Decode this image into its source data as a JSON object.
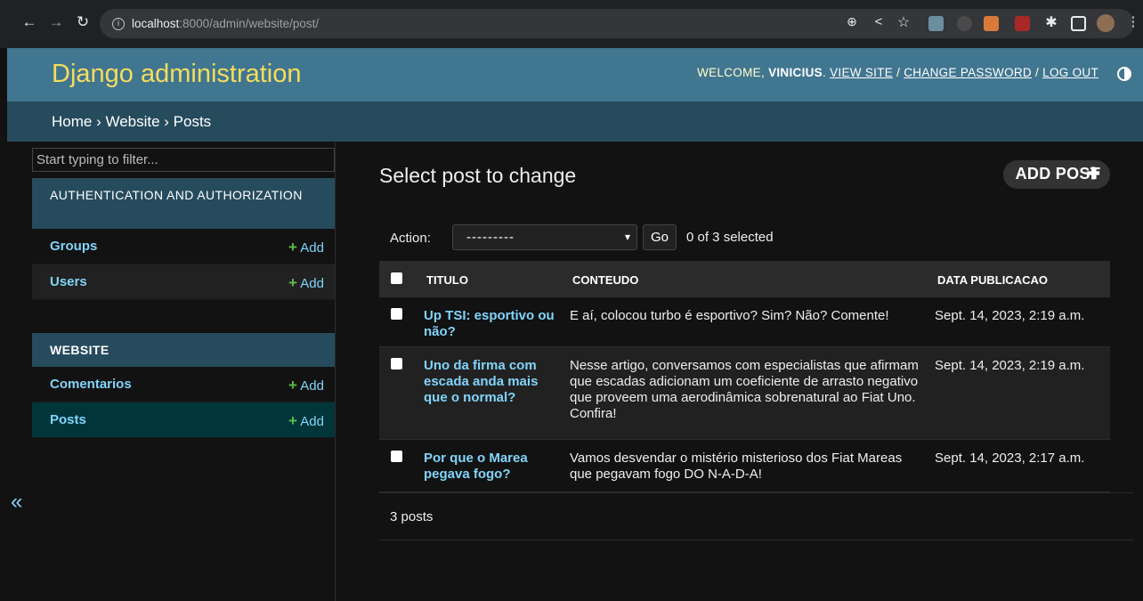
{
  "browser": {
    "url_host": "localhost",
    "url_path": ":8000/admin/website/post/",
    "icons": [
      "back-icon",
      "forward-icon",
      "reload-icon",
      "info-icon",
      "zoom-icon",
      "share-icon",
      "star-icon",
      "extension-icons",
      "profile-avatar"
    ]
  },
  "header": {
    "brand": "Django administration",
    "welcome": "WELCOME, ",
    "user": "VINICIUS",
    "view_site": "VIEW SITE",
    "change_password": "CHANGE PASSWORD",
    "log_out": "LOG OUT",
    "sep": " / "
  },
  "breadcrumbs": "Home › Website › Posts",
  "sidebar": {
    "filter_placeholder": "Start typing to filter...",
    "modules": [
      {
        "caption": "AUTHENTICATION AND AUTHORIZATION",
        "rows": [
          "Groups",
          "Users"
        ]
      },
      {
        "caption": "WEBSITE",
        "rows": [
          "Comentarios",
          "Posts"
        ]
      }
    ],
    "add_label": "Add",
    "collapse": "«"
  },
  "main": {
    "title": "Select post to change",
    "add_button": "ADD POST",
    "action_label": "Action:",
    "action_value": "---------",
    "go": "Go",
    "selected": "0 of 3 selected",
    "columns": [
      "TITULO",
      "CONTEUDO",
      "DATA PUBLICACAO"
    ],
    "rows": [
      {
        "titulo": "Up TSI: esportivo ou não?",
        "conteudo": "E aí, colocou turbo é esportivo? Sim? Não? Comente!",
        "data": "Sept. 14, 2023, 2:19 a.m."
      },
      {
        "titulo": "Uno da firma com escada anda mais que o normal?",
        "conteudo": "Nesse artigo, conversamos com especialistas que afirmam que escadas adicionam um coeficiente de arrasto negativo que proveem uma aerodinâmica sobrenatural ao Fiat Uno. Confira!",
        "data": "Sept. 14, 2023, 2:19 a.m."
      },
      {
        "titulo": "Por que o Marea pegava fogo?",
        "conteudo": "Vamos desvendar o mistério misterioso dos Fiat Mareas que pegavam fogo DO N-A-D-A!",
        "data": "Sept. 14, 2023, 2:17 a.m."
      }
    ],
    "count": "3 posts"
  }
}
